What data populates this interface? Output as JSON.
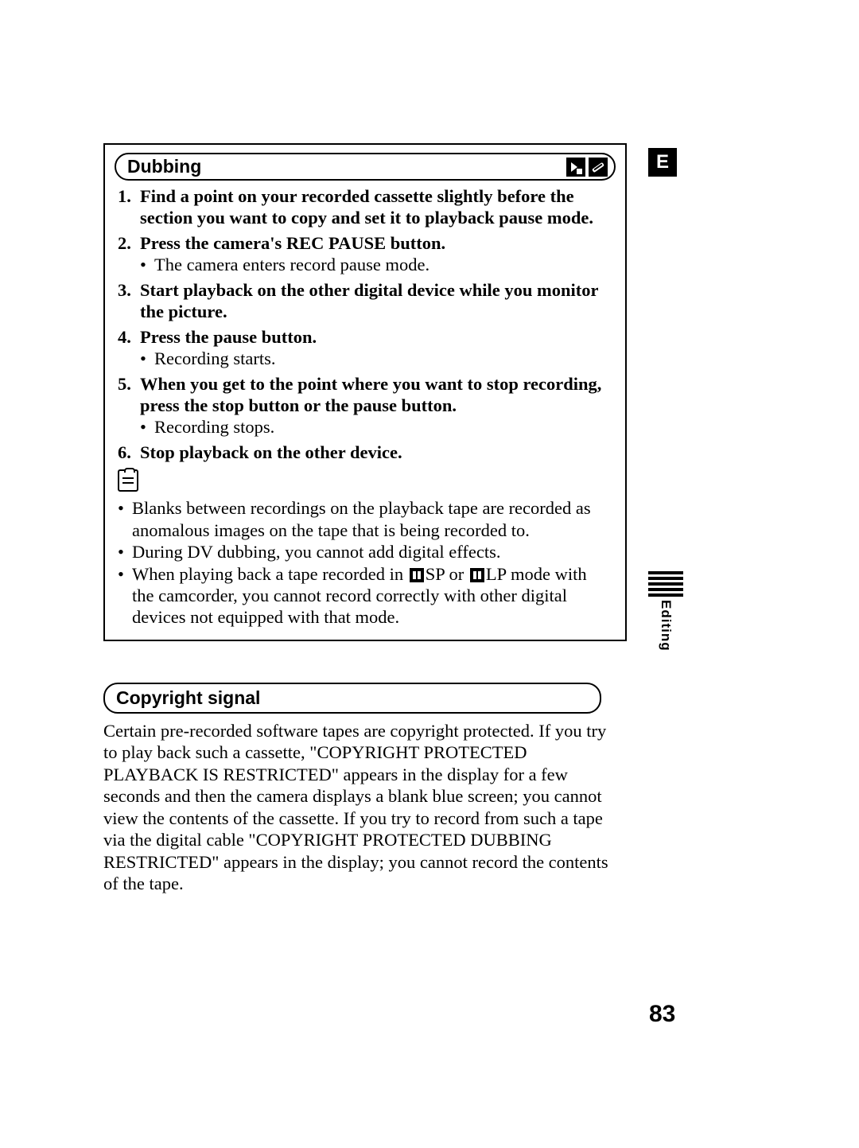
{
  "side_letter": "E",
  "side_tab_label": "Editing",
  "page_number": "83",
  "dubbing": {
    "heading": "Dubbing",
    "steps": [
      {
        "num": "1.",
        "bold": "Find a point on your recorded cassette slightly before the section you want to copy and set it to playback pause mode."
      },
      {
        "num": "2.",
        "bold": "Press the camera's REC PAUSE button.",
        "sub": "The camera enters record pause mode."
      },
      {
        "num": "3.",
        "bold": "Start playback on the other digital device while you monitor the picture."
      },
      {
        "num": "4.",
        "bold": "Press the pause button.",
        "sub": "Recording starts."
      },
      {
        "num": "5.",
        "bold": "When you get to the point where you want to stop recording, press the stop button or the pause button.",
        "sub": "Recording stops."
      },
      {
        "num": "6.",
        "bold": "Stop playback on the other device."
      }
    ],
    "notes": {
      "n1": "Blanks between recordings on the playback tape are recorded as anomalous images on the tape that is being recorded to.",
      "n2": "During DV dubbing, you cannot add digital effects.",
      "n3_pre": "When playing back a tape recorded in ",
      "n3_sp": "SP",
      "n3_mid": " or ",
      "n3_lp": "LP",
      "n3_post": " mode with the camcorder, you cannot record correctly with other digital devices not equipped with that mode."
    }
  },
  "copyright": {
    "heading": "Copyright signal",
    "para": "Certain pre-recorded software tapes are copyright protected. If you try to play back such a cassette, \"COPYRIGHT PROTECTED PLAYBACK IS RESTRICTED\" appears in the display for a few seconds and then the camera displays a blank blue screen; you cannot view the contents of the cassette. If you try to record from such a tape via the digital cable \"COPYRIGHT PROTECTED DUBBING RESTRICTED\" appears in the display; you cannot record the contents of the tape."
  }
}
